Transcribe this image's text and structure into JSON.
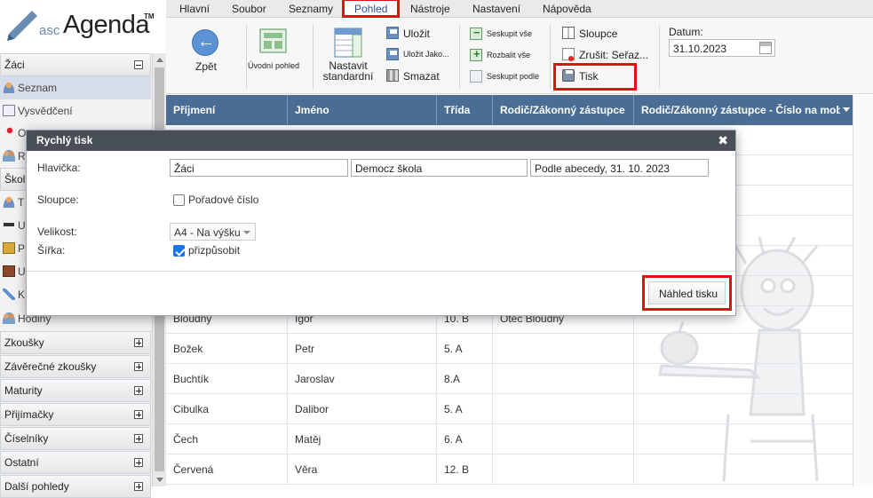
{
  "app": {
    "logo_prefix": "asc",
    "logo_name": "Agenda",
    "logo_tm": "TM"
  },
  "menu": [
    "Hlavní",
    "Soubor",
    "Seznamy",
    "Pohled",
    "Nástroje",
    "Nastavení",
    "Nápověda"
  ],
  "menu_active": "Pohled",
  "ribbon": {
    "back": "Zpět",
    "home_view": "Úvodní pohled",
    "set_standard_line1": "Nastavit",
    "set_standard_line2": "standardní",
    "save": "Uložit",
    "save_as": "Uložit Jako...",
    "delete": "Smazat",
    "collapse_all": "Seskupit vše",
    "expand_all": "Rozbalit vše",
    "group_by": "Seskupit podle",
    "columns": "Sloupce",
    "cancel_sort": "Zrušit: Seřaz...",
    "print": "Tisk",
    "date_label": "Datum:",
    "date_value": "31.10.2023"
  },
  "sidebar": {
    "section_zaci": "Žáci",
    "items_zaci": [
      {
        "label": "Seznam",
        "icon": "person-icon"
      },
      {
        "label": "Vysvědčení",
        "icon": "report-card-icon"
      },
      {
        "label": "O",
        "icon": "pin-icon"
      },
      {
        "label": "R",
        "icon": "people-icon"
      }
    ],
    "section_skola": "Škola",
    "items_skola": [
      {
        "label": "T",
        "icon": "teacher-icon"
      },
      {
        "label": "U",
        "icon": "graduation-cap-icon"
      },
      {
        "label": "P",
        "icon": "book-icon"
      },
      {
        "label": "U",
        "icon": "book-icon"
      },
      {
        "label": "K",
        "icon": "link-icon"
      },
      {
        "label": "Hodiny",
        "icon": "people-icon"
      }
    ],
    "sections": [
      "Zkoušky",
      "Závěrečné zkoušky",
      "Maturity",
      "Přijímačky",
      "Číselníky",
      "Ostatní",
      "Další pohledy"
    ]
  },
  "table": {
    "columns": [
      "Příjmení",
      "Jméno",
      "Třída",
      "Rodič/Zákonný zástupce",
      "Rodič/Zákonný zástupce - Číslo na mobil"
    ],
    "rows": [
      [
        "Bloudný",
        "Igor",
        "10. B",
        "Otec Bloudný",
        ""
      ],
      [
        "Božek",
        "Petr",
        "5. A",
        "",
        ""
      ],
      [
        "Buchtík",
        "Jaroslav",
        "8.A",
        "",
        ""
      ],
      [
        "Cibulka",
        "Dalibor",
        "5. A",
        "",
        ""
      ],
      [
        "Čech",
        "Matěj",
        "6. A",
        "",
        ""
      ],
      [
        "Červená",
        "Věra",
        "12. B",
        "",
        ""
      ]
    ]
  },
  "dialog": {
    "title": "Rychlý tisk",
    "close": "✖",
    "header_label": "Hlavička:",
    "header_values": [
      "Žáci",
      "Democz škola",
      "Podle abecedy, 31. 10. 2023"
    ],
    "columns_label": "Sloupce:",
    "order_number": "Pořadové číslo",
    "order_number_checked": false,
    "size_label": "Velikost:",
    "size_value": "A4 - Na výšku",
    "width_label": "Šířka:",
    "fit": "přizpůsobit",
    "fit_checked": true,
    "preview_button": "Náhled tisku"
  },
  "colors": {
    "table_header": "#4a6d95",
    "dialog_header": "#494f57",
    "highlight": "#e21111",
    "sidebar_active": "#d6dde8"
  }
}
